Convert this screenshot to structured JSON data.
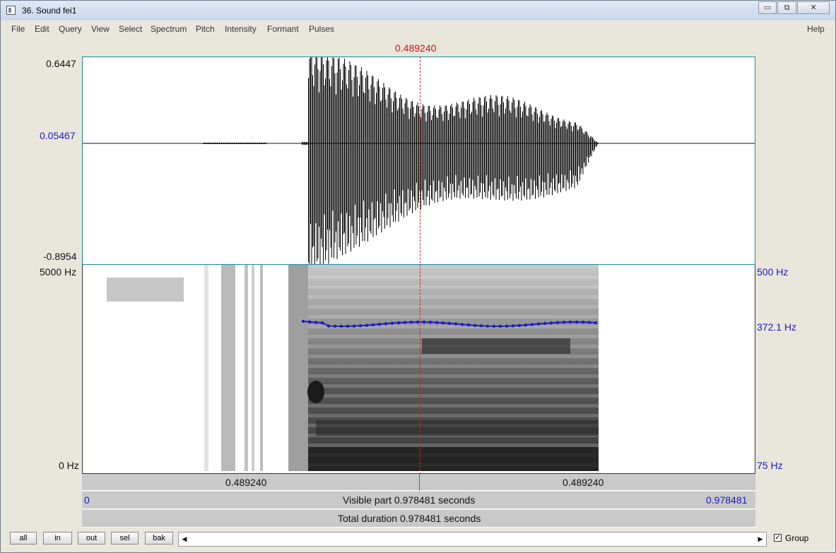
{
  "window": {
    "title": "36. Sound fei1",
    "controls": {
      "minimize": "▭",
      "restore": "⧉",
      "close": "✕"
    }
  },
  "menu": [
    "File",
    "Edit",
    "Query",
    "View",
    "Select",
    "Spectrum",
    "Pitch",
    "Intensity",
    "Formant",
    "Pulses"
  ],
  "help": "Help",
  "cursor_time": "0.489240",
  "waveform": {
    "y_max": "0.6447",
    "y_cursor": "0.05467",
    "y_min": "-0.8954"
  },
  "spectrogram": {
    "freq_max": "5000 Hz",
    "freq_min": "0 Hz",
    "pitch_max": "500 Hz",
    "pitch_value": "372.1 Hz",
    "pitch_min": "75 Hz"
  },
  "time_bar": {
    "left_label": "0.489240",
    "right_label": "0.489240"
  },
  "visible_bar": {
    "start": "0",
    "text": "Visible part 0.978481 seconds",
    "end": "0.978481"
  },
  "total_bar": {
    "text": "Total duration 0.978481 seconds"
  },
  "buttons": {
    "all": "all",
    "in": "in",
    "out": "out",
    "sel": "sel",
    "bak": "bak"
  },
  "scroll": {
    "left": "◀",
    "right": "▶"
  },
  "group": {
    "label": "Group",
    "check": "✓"
  },
  "colors": {
    "cursor": "#cc1111",
    "pitch": "#1a1ac8",
    "axis_blue": "#1a1ac8"
  }
}
